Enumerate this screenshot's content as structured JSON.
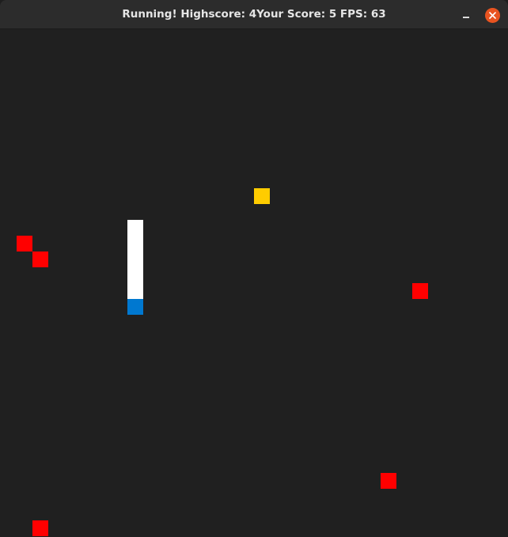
{
  "window": {
    "title": "Running! Highscore: 4Your Score: 5 FPS: 63"
  },
  "colors": {
    "background": "#202020",
    "titlebar": "#2c2c2c",
    "snake_body": "#ffffff",
    "snake_head": "#0078d0",
    "food": "#ffcc00",
    "obstacle": "#ff0000",
    "close_button": "#e95420"
  },
  "icons": {
    "minimize": "minimize-icon",
    "close": "close-icon"
  }
}
